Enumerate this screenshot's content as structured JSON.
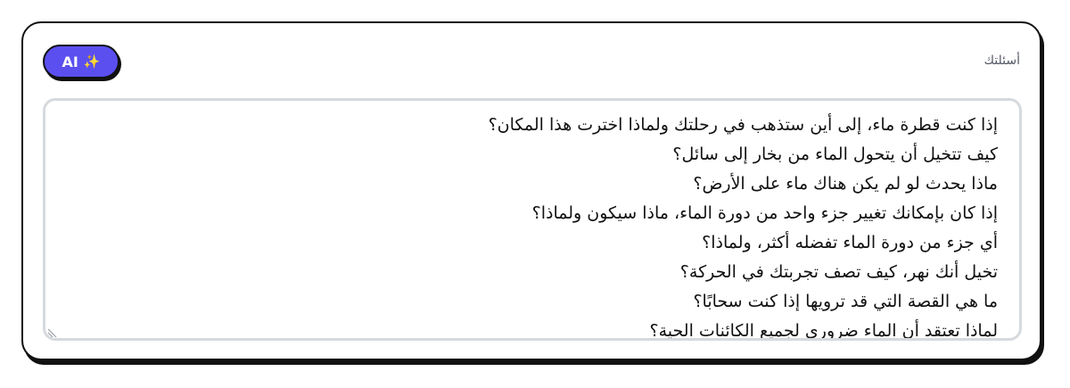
{
  "field": {
    "label": "أسئلتك"
  },
  "ai_button": {
    "label": "AI",
    "icon": "sparkles-icon"
  },
  "questions": [
    "إذا كنت قطرة ماء، إلى أين ستذهب في رحلتك ولماذا اخترت هذا المكان؟",
    "كيف تتخيل أن يتحول الماء من بخار إلى سائل؟",
    "ماذا يحدث لو لم يكن هناك ماء على الأرض؟",
    "إذا كان بإمكانك تغيير جزء واحد من دورة الماء، ماذا سيكون ولماذا؟",
    "أي جزء من دورة الماء تفضله أكثر، ولماذا؟",
    "تخيل أنك نهر، كيف تصف تجربتك في الحركة؟",
    "ما هي القصة التي قد ترويها إذا كنت سحابًا؟",
    "لماذا تعتقد أن الماء ضروري لجميع الكائنات الحية؟"
  ],
  "colors": {
    "accent": "#5b4ff0",
    "border": "#111111",
    "field_border": "#d6d9de"
  }
}
